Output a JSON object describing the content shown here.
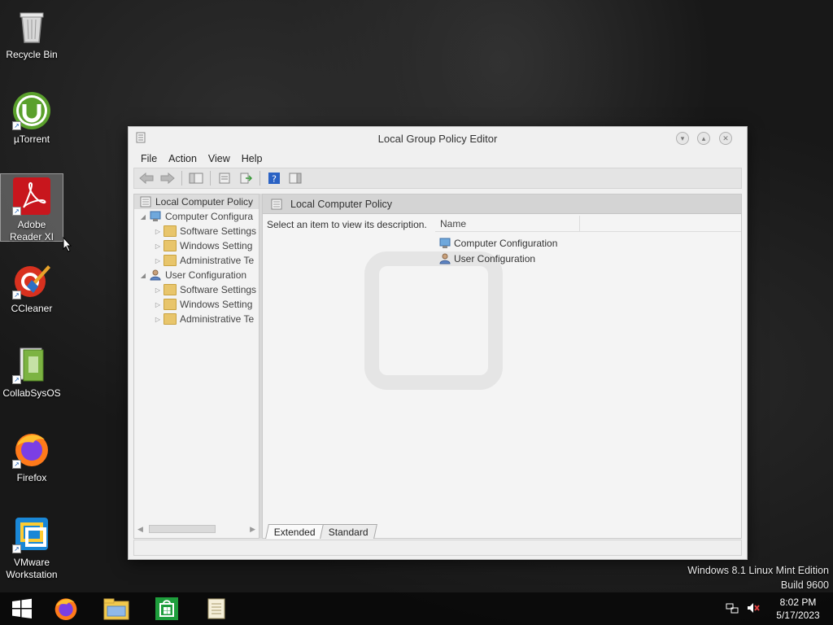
{
  "desktop": {
    "icons": [
      {
        "label": "Recycle Bin"
      },
      {
        "label": "µTorrent"
      },
      {
        "label": "Adobe Reader XI"
      },
      {
        "label": "CCleaner"
      },
      {
        "label": "CollabSysOS"
      },
      {
        "label": "Firefox"
      },
      {
        "label": "VMware Workstation"
      }
    ]
  },
  "window": {
    "title": "Local Group Policy Editor",
    "menu": [
      "File",
      "Action",
      "View",
      "Help"
    ],
    "tree": {
      "root": "Local Computer Policy",
      "items": [
        "Computer Configura",
        "Software Settings",
        "Windows Setting",
        "Administrative Te",
        "User Configuration",
        "Software Settings",
        "Windows Setting",
        "Administrative Te"
      ]
    },
    "pane": {
      "header": "Local Computer Policy",
      "description": "Select an item to view its description.",
      "column_name": "Name",
      "items": [
        "Computer Configuration",
        "User Configuration"
      ]
    },
    "tabs": [
      "Extended",
      "Standard"
    ]
  },
  "edition": {
    "line1": "Windows 8.1 Linux Mint Edition",
    "line2": "Build 9600"
  },
  "taskbar": {
    "time": "8:02 PM",
    "date": "5/17/2023"
  },
  "colors": {
    "adobe_red": "#c8161d",
    "utorrent_green": "#5aa02c",
    "store_green": "#1e9e3c",
    "vmware_blue": "#1a87d6"
  }
}
